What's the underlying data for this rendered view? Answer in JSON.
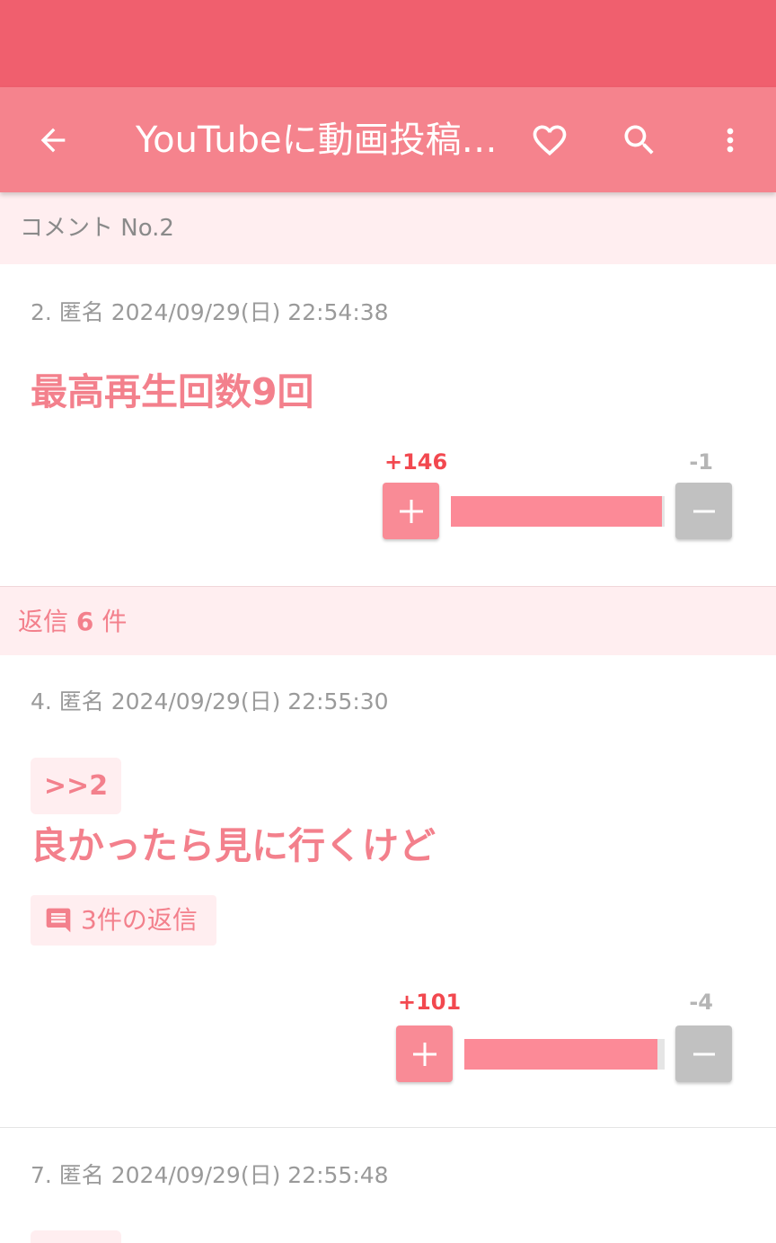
{
  "app_bar": {
    "title": "YouTubeに動画投稿したんだけどさぁ…",
    "icons": [
      "arrow-back-icon",
      "heart-outline-icon",
      "search-icon",
      "more-vert-icon"
    ]
  },
  "colors": {
    "status_bar": "#f05f6e",
    "app_bar": "#f5838d",
    "accent_text": "#f3808c",
    "plus_count": "#f2484f",
    "section_bg": "#ffeef0"
  },
  "comment_header": {
    "label": "コメント No.2"
  },
  "comments": [
    {
      "meta": "2. 匿名 2024/09/29(日) 22:54:38",
      "text": "最高再生回数9回",
      "plus_label": "+146",
      "minus_label": "-1",
      "plus_ratio": 0.986
    },
    {
      "meta": "4. 匿名 2024/09/29(日) 22:55:30",
      "anchor": ">>2",
      "text": "良かったら見に行くけど",
      "replies_label": "3件の返信",
      "plus_label": "+101",
      "minus_label": "-4",
      "plus_ratio": 0.962
    },
    {
      "meta": "7. 匿名 2024/09/29(日) 22:55:48"
    }
  ],
  "replies_header": {
    "prefix": "返信",
    "count": "6",
    "suffix": "件"
  }
}
